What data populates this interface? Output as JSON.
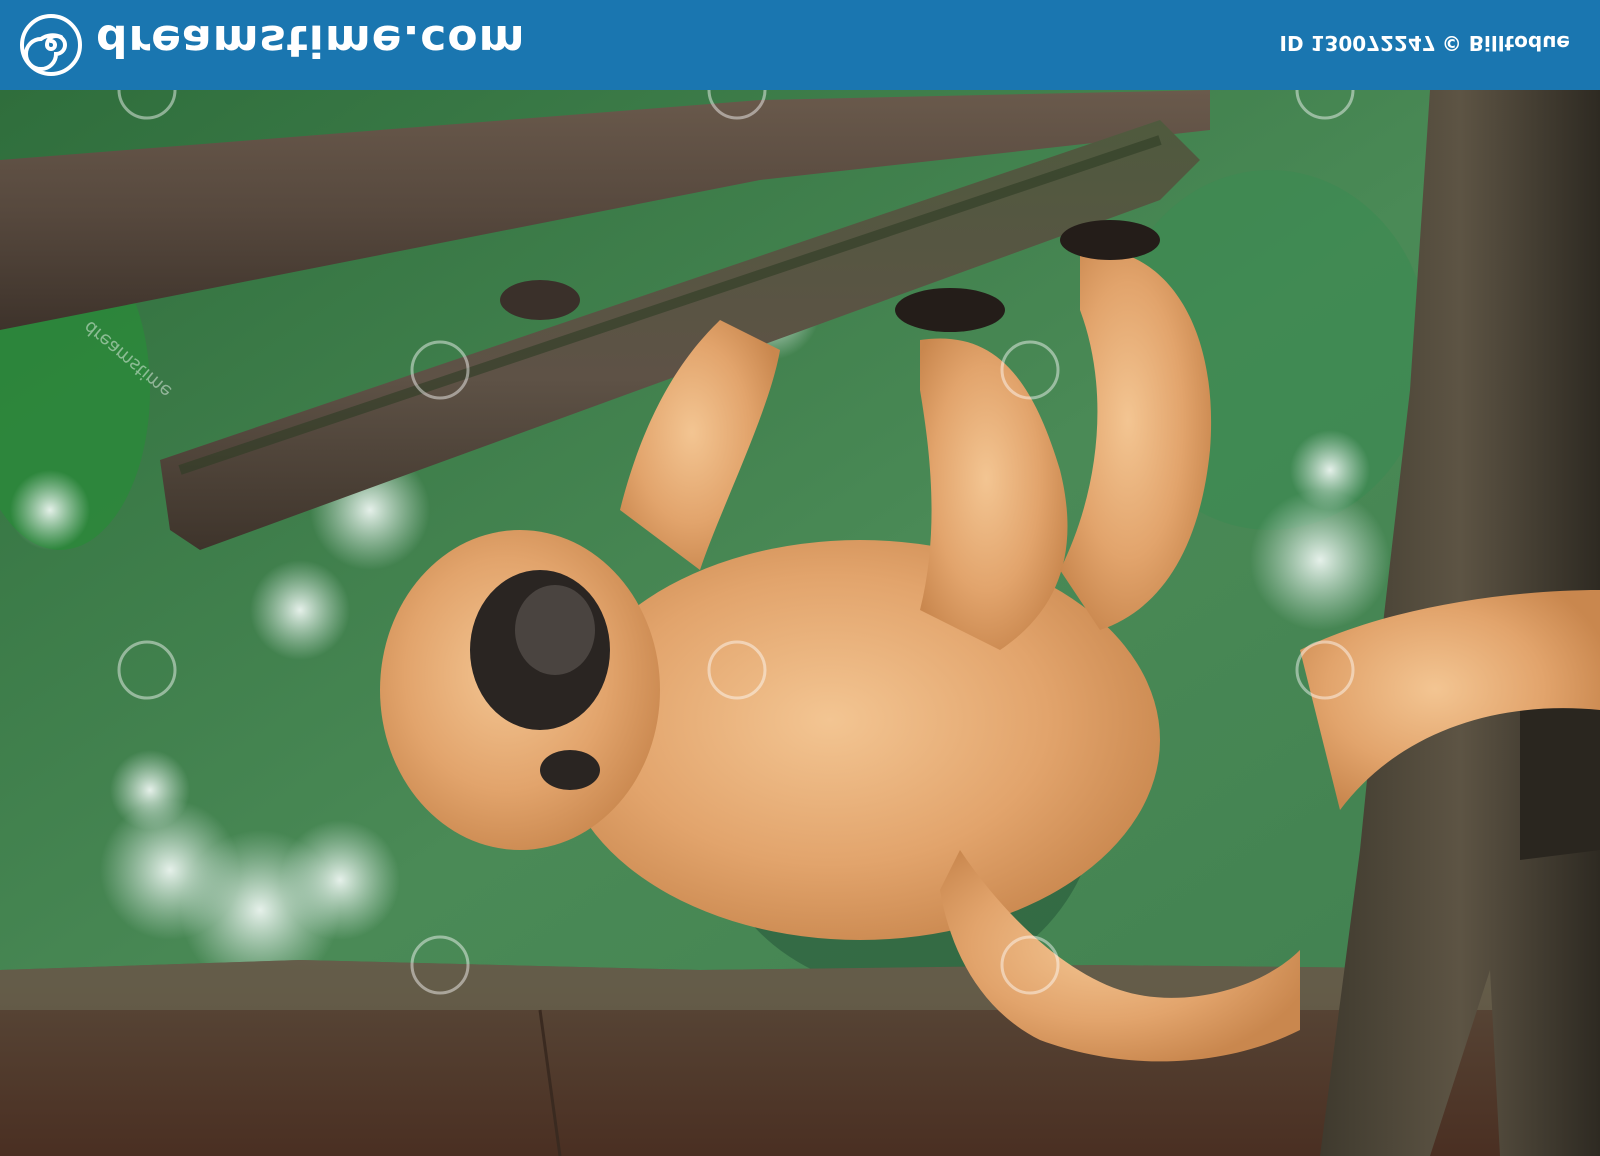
{
  "header": {
    "brand": "dreamstime.com",
    "image_id": "ID 130072247",
    "copyright": "© Billtodue",
    "logo_icon": "spiral-logo-icon",
    "background_color": "#1a76b0",
    "text_color": "#ffffff"
  },
  "photo": {
    "watermark_icon": "spiral-watermark-icon",
    "watermark_text": "dreamstime"
  }
}
